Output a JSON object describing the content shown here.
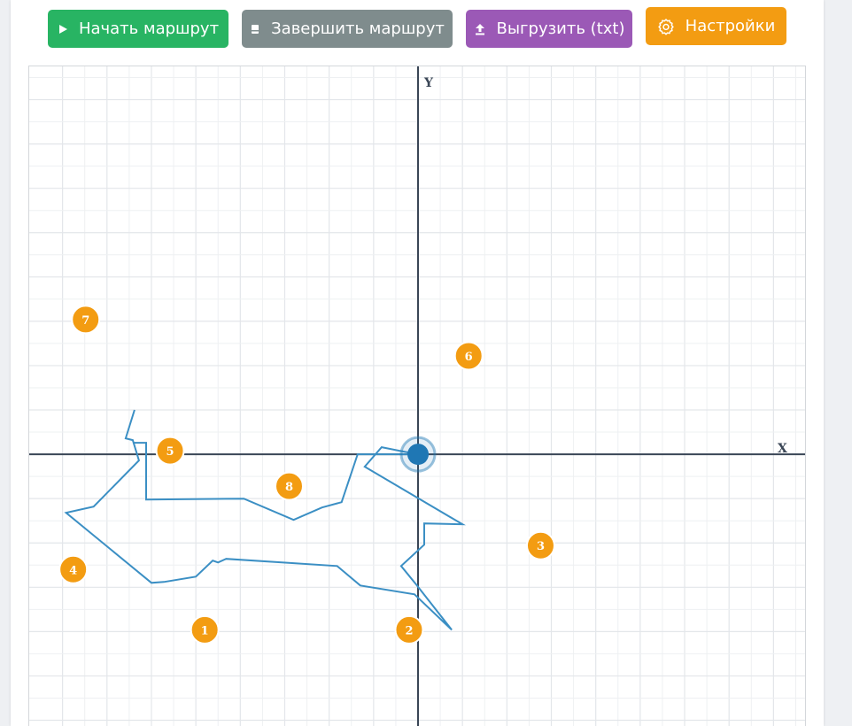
{
  "toolbar": {
    "start_label": "Начать маршрут",
    "finish_label": "Завершить маршрут",
    "export_label": "Выгрузить (txt)",
    "settings_label": "Настройки",
    "icons": {
      "start": "play-icon",
      "finish": "stop-icon",
      "export": "upload-icon",
      "settings": "gear-icon"
    },
    "colors": {
      "start": "#28b463",
      "finish": "#7f8c8d",
      "export": "#9b59b6",
      "settings": "#f39c12"
    }
  },
  "graph": {
    "x_axis_label": "X",
    "y_axis_label": "Y",
    "grid_step": 1,
    "x_range": [
      -8.75,
      8.75
    ],
    "y_range": [
      -6.15,
      8.75
    ],
    "route_color": "#3b8fc4",
    "marker_color": "#f39c12",
    "current_position_color": "#1f77b4",
    "current_position": [
      0,
      0
    ],
    "route": [
      [
        -6.38,
        1.0
      ],
      [
        -6.58,
        0.36
      ],
      [
        -6.42,
        0.32
      ],
      [
        -6.28,
        -0.14
      ],
      [
        -7.3,
        -1.18
      ],
      [
        -7.92,
        -1.32
      ],
      [
        -6.0,
        -2.9
      ],
      [
        -5.72,
        -2.88
      ],
      [
        -5.0,
        -2.76
      ],
      [
        -4.62,
        -2.4
      ],
      [
        -4.5,
        -2.44
      ],
      [
        -4.32,
        -2.36
      ],
      [
        -1.82,
        -2.52
      ],
      [
        -1.3,
        -2.96
      ],
      [
        -0.08,
        -3.16
      ],
      [
        0.76,
        -3.96
      ],
      [
        -0.04,
        -2.94
      ],
      [
        -0.38,
        -2.52
      ],
      [
        0.14,
        -2.04
      ],
      [
        0.14,
        -1.56
      ],
      [
        1.0,
        -1.58
      ],
      [
        -1.2,
        -0.28
      ],
      [
        -0.82,
        0.16
      ],
      [
        -0.42,
        0.08
      ],
      [
        0.0,
        0.0
      ],
      [
        -1.36,
        0.0
      ],
      [
        -1.72,
        -1.08
      ],
      [
        -2.16,
        -1.2
      ],
      [
        -2.8,
        -1.48
      ],
      [
        -3.92,
        -1.0
      ],
      [
        -6.12,
        -1.02
      ],
      [
        -6.12,
        0.26
      ],
      [
        -6.42,
        0.26
      ]
    ],
    "markers": [
      {
        "label": "1",
        "x": -4.8,
        "y": -3.96
      },
      {
        "label": "2",
        "x": -0.2,
        "y": -3.96
      },
      {
        "label": "3",
        "x": 2.76,
        "y": -2.06
      },
      {
        "label": "4",
        "x": -7.76,
        "y": -2.6
      },
      {
        "label": "5",
        "x": -5.58,
        "y": 0.08
      },
      {
        "label": "6",
        "x": 1.14,
        "y": 2.22
      },
      {
        "label": "7",
        "x": -7.48,
        "y": 3.04
      },
      {
        "label": "8",
        "x": -2.9,
        "y": -0.72
      }
    ]
  }
}
